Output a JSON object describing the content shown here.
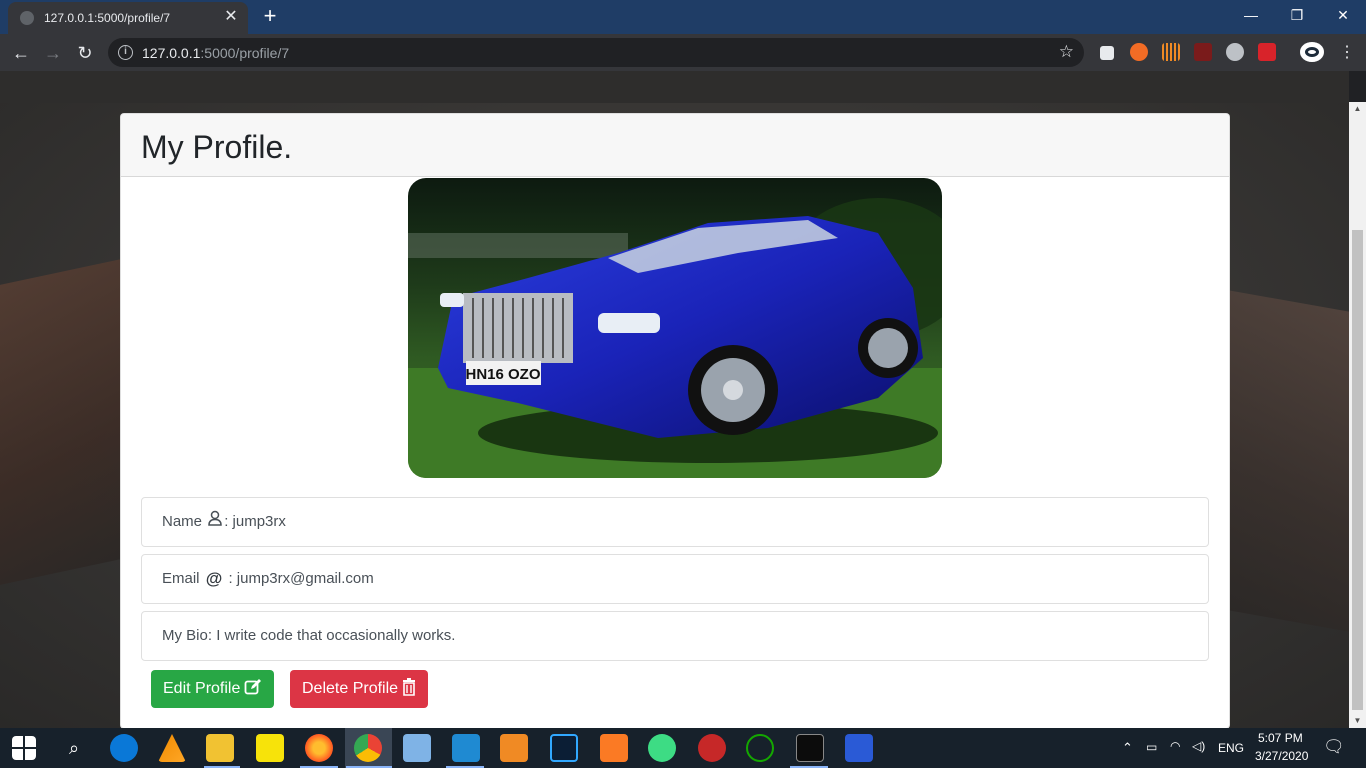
{
  "browser": {
    "tab": {
      "title": "127.0.0.1:5000/profile/7",
      "close_label": "✕"
    },
    "new_tab_label": "+",
    "window_controls": {
      "minimize": "—",
      "maximize": "❐",
      "close": "✕"
    },
    "nav": {
      "back": "←",
      "forward": "→",
      "reload": "↻"
    },
    "address": {
      "host": "127.0.0.1",
      "rest": ":5000/profile/7",
      "info_glyph": "i"
    },
    "bookmark_glyph": "☆",
    "extensions": [
      "pen-ext-icon",
      "honey-ext-icon",
      "audio-ext-icon",
      "pdf-ext-icon",
      "clock-ext-icon",
      "flash-ext-icon",
      "eye-ext-icon"
    ]
  },
  "page": {
    "title": "My Profile.",
    "photo_alt": "Blue Rolls-Royce convertible",
    "plate": "HN16 OZO",
    "fields": [
      {
        "label": "Name",
        "icon": "user-icon",
        "sep": ":",
        "value": "jump3rx"
      },
      {
        "label": "Email",
        "icon": "at-icon",
        "sep": ":",
        "value": "jump3rx@gmail.com"
      },
      {
        "label": "My Bio:",
        "value": "I write code that occasionally works."
      }
    ],
    "buttons": {
      "edit": {
        "label": "Edit Profile",
        "color": "#28a745",
        "icon": "edit-icon"
      },
      "delete": {
        "label": "Delete Profile",
        "color": "#dc3545",
        "icon": "trash-icon"
      }
    }
  },
  "taskbar": {
    "apps": [
      "start-icon",
      "search-icon",
      "edge-icon",
      "vlc-icon",
      "file-explorer-icon",
      "sticky-notes-icon",
      "firefox-icon",
      "chrome-icon",
      "virtualbox-icon",
      "vscode-icon",
      "media-player-icon",
      "photoshop-icon",
      "xampp-icon",
      "android-studio-icon",
      "unknown-app-icon",
      "upwork-icon",
      "terminal-icon",
      "powershell-icon"
    ],
    "tray": {
      "language": "ENG",
      "time": "5:07 PM",
      "date": "3/27/2020"
    }
  },
  "colors": {
    "tab_strip": "#1f3d66",
    "toolbar": "#35363a",
    "taskbar": "#17212b"
  }
}
